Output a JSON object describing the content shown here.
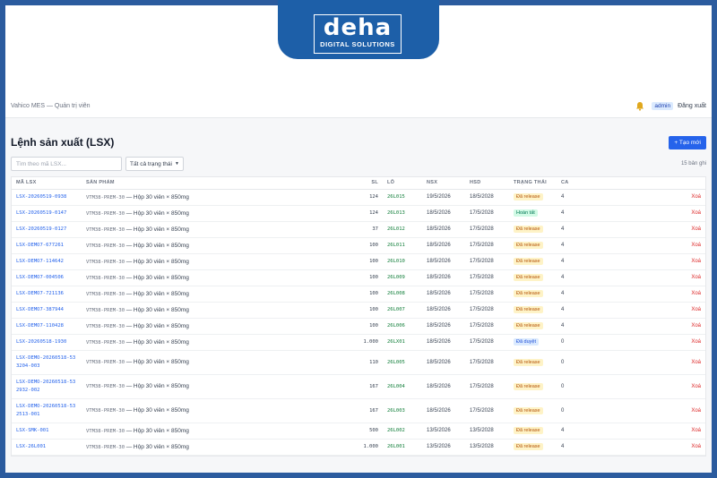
{
  "banner": {
    "logo_text": "deha",
    "logo_sub": "DIGITAL SOLUTIONS"
  },
  "topbar": {
    "app_title": "Vahico MES — Quản trị viên",
    "user": "admin",
    "logout": "Đăng xuất"
  },
  "page": {
    "title": "Lệnh sản xuất (LSX)",
    "new_button": "+ Tạo mới"
  },
  "filters": {
    "search_placeholder": "Tìm theo mã LSX...",
    "status_value": "Tất cả trạng thái",
    "count": "15 bản ghi"
  },
  "table": {
    "columns": [
      "MÃ LSX",
      "SẢN PHẨM",
      "SL",
      "LÔ",
      "NSX",
      "HSD",
      "TRẠNG THÁI",
      "CA"
    ],
    "delete_label": "Xoá",
    "rows": [
      {
        "code": "LSX-20260519-0938",
        "sku": "VTM38-PREM-30",
        "product": "Hộp 30 viên × 850mg",
        "qty": "124",
        "lot": "26L015",
        "mfg": "19/5/2026",
        "exp": "18/5/2028",
        "status": "Đã release",
        "status_color": "#fef3c7",
        "status_text_color": "#b45309",
        "shift": "4"
      },
      {
        "code": "LSX-20260519-0147",
        "sku": "VTM38-PREM-30",
        "product": "Hộp 30 viên × 850mg",
        "qty": "124",
        "lot": "26L013",
        "mfg": "18/5/2026",
        "exp": "17/5/2028",
        "status": "Hoàn tất",
        "status_color": "#d1fae5",
        "status_text_color": "#047857",
        "shift": "4"
      },
      {
        "code": "LSX-20260519-0127",
        "sku": "VTM38-PREM-30",
        "product": "Hộp 30 viên × 850mg",
        "qty": "37",
        "lot": "26L012",
        "mfg": "18/5/2026",
        "exp": "17/5/2028",
        "status": "Đã release",
        "status_color": "#fef3c7",
        "status_text_color": "#b45309",
        "shift": "4"
      },
      {
        "code": "LSX-DEMO7-677261",
        "sku": "VTM38-PREM-30",
        "product": "Hộp 30 viên × 850mg",
        "qty": "100",
        "lot": "26L011",
        "mfg": "18/5/2026",
        "exp": "17/5/2028",
        "status": "Đã release",
        "status_color": "#fef3c7",
        "status_text_color": "#b45309",
        "shift": "4"
      },
      {
        "code": "LSX-DEMO7-114642",
        "sku": "VTM38-PREM-30",
        "product": "Hộp 30 viên × 850mg",
        "qty": "100",
        "lot": "26L010",
        "mfg": "18/5/2026",
        "exp": "17/5/2028",
        "status": "Đã release",
        "status_color": "#fef3c7",
        "status_text_color": "#b45309",
        "shift": "4"
      },
      {
        "code": "LSX-DEMO7-004506",
        "sku": "VTM38-PREM-30",
        "product": "Hộp 30 viên × 850mg",
        "qty": "100",
        "lot": "26L009",
        "mfg": "18/5/2026",
        "exp": "17/5/2028",
        "status": "Đã release",
        "status_color": "#fef3c7",
        "status_text_color": "#b45309",
        "shift": "4"
      },
      {
        "code": "LSX-DEMO7-721136",
        "sku": "VTM38-PREM-30",
        "product": "Hộp 30 viên × 850mg",
        "qty": "100",
        "lot": "26L008",
        "mfg": "18/5/2026",
        "exp": "17/5/2028",
        "status": "Đã release",
        "status_color": "#fef3c7",
        "status_text_color": "#b45309",
        "shift": "4"
      },
      {
        "code": "LSX-DEMO7-387944",
        "sku": "VTM38-PREM-30",
        "product": "Hộp 30 viên × 850mg",
        "qty": "100",
        "lot": "26L007",
        "mfg": "18/5/2026",
        "exp": "17/5/2028",
        "status": "Đã release",
        "status_color": "#fef3c7",
        "status_text_color": "#b45309",
        "shift": "4"
      },
      {
        "code": "LSX-DEMO7-110428",
        "sku": "VTM38-PREM-30",
        "product": "Hộp 30 viên × 850mg",
        "qty": "100",
        "lot": "26L006",
        "mfg": "18/5/2026",
        "exp": "17/5/2028",
        "status": "Đã release",
        "status_color": "#fef3c7",
        "status_text_color": "#b45309",
        "shift": "4"
      },
      {
        "code": "LSX-20260518-1930",
        "sku": "VTM38-PREM-30",
        "product": "Hộp 30 viên × 850mg",
        "qty": "1.000",
        "lot": "26LX01",
        "mfg": "18/5/2026",
        "exp": "17/5/2028",
        "status": "Đã duyệt",
        "status_color": "#dbeafe",
        "status_text_color": "#1d4ed8",
        "shift": "0"
      },
      {
        "code": "LSX-DEMO-20260518-533204-003",
        "sku": "VTM38-PREM-30",
        "product": "Hộp 30 viên × 850mg",
        "qty": "110",
        "lot": "26L005",
        "mfg": "18/5/2026",
        "exp": "17/5/2028",
        "status": "Đã release",
        "status_color": "#fef3c7",
        "status_text_color": "#b45309",
        "shift": "0"
      },
      {
        "code": "LSX-DEMO-20260518-532932-002",
        "sku": "VTM38-PREM-30",
        "product": "Hộp 30 viên × 850mg",
        "qty": "167",
        "lot": "26L004",
        "mfg": "18/5/2026",
        "exp": "17/5/2028",
        "status": "Đã release",
        "status_color": "#fef3c7",
        "status_text_color": "#b45309",
        "shift": "0"
      },
      {
        "code": "LSX-DEMO-20260518-532513-001",
        "sku": "VTM38-PREM-30",
        "product": "Hộp 30 viên × 850mg",
        "qty": "167",
        "lot": "26L003",
        "mfg": "18/5/2026",
        "exp": "17/5/2028",
        "status": "Đã release",
        "status_color": "#fef3c7",
        "status_text_color": "#b45309",
        "shift": "0"
      },
      {
        "code": "LSX-SMK-001",
        "sku": "VTM38-PREM-30",
        "product": "Hộp 30 viên × 850mg",
        "qty": "500",
        "lot": "26L002",
        "mfg": "13/5/2026",
        "exp": "13/5/2028",
        "status": "Đã release",
        "status_color": "#fef3c7",
        "status_text_color": "#b45309",
        "shift": "4"
      },
      {
        "code": "LSX-26L001",
        "sku": "VTM38-PREM-30",
        "product": "Hộp 30 viên × 850mg",
        "qty": "1.000",
        "lot": "26L001",
        "mfg": "13/5/2026",
        "exp": "13/5/2028",
        "status": "Đã release",
        "status_color": "#fef3c7",
        "status_text_color": "#b45309",
        "shift": "4"
      }
    ]
  }
}
